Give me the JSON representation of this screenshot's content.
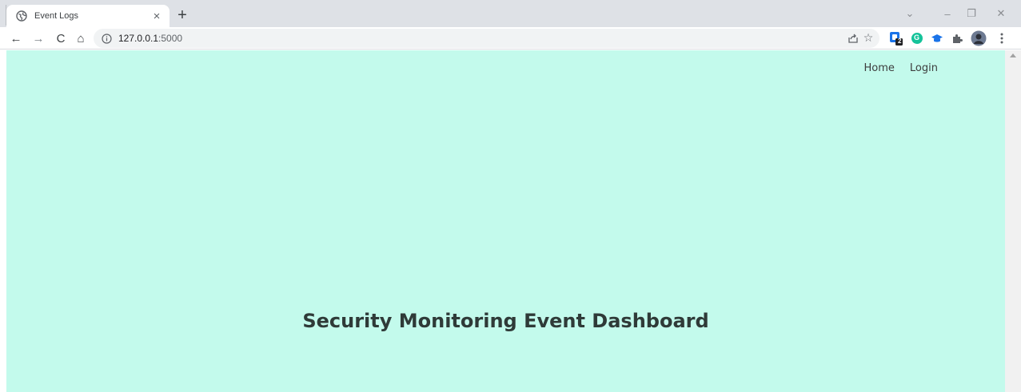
{
  "browser": {
    "tab": {
      "title": "Event Logs",
      "favicon": "globe-icon",
      "close_glyph": "×"
    },
    "new_tab_glyph": "+",
    "window_controls": {
      "tab_search": "⌄",
      "minimize": "–",
      "restore": "❐",
      "close": "✕"
    },
    "toolbar": {
      "back": "←",
      "forward": "→",
      "reload": "C",
      "home": "⌂",
      "url_host": "127.0.0.1",
      "url_port": ":5000",
      "star": "☆"
    },
    "extensions": {
      "badge_count": "2",
      "grammarly_letter": "G"
    }
  },
  "page": {
    "nav": {
      "home": "Home",
      "login": "Login"
    },
    "title": "Security Monitoring Event Dashboard",
    "background": "#c3faec"
  }
}
